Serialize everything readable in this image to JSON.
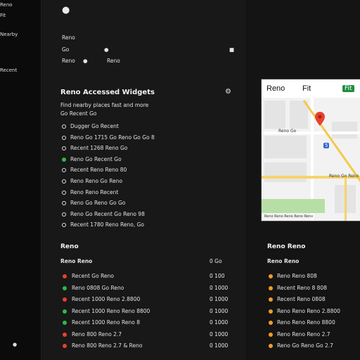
{
  "sidebar": {
    "items": [
      "Reno",
      "Fit",
      "Nearby",
      "Recent"
    ]
  },
  "header": {
    "line1": "●",
    "line2": "Reno",
    "line3_left": "Go",
    "line3_mid": "●",
    "line3_right": "■",
    "line4_left": "Reno",
    "line4_mid": "●",
    "line4_right": "Reno"
  },
  "search_section": {
    "title": "Reno Accessed Widgets",
    "subtitle_1": "Find nearby places fast and more",
    "subtitle_2": "Go Recent Go",
    "options": [
      {
        "label": "Dugger Go Recent",
        "style": "ring"
      },
      {
        "label": "Reno Go 1715 Go Reno Go Go 8",
        "style": "ring"
      },
      {
        "label": "Recent 1268 Reno Go",
        "style": "ring"
      },
      {
        "label": "Reno Go Recent Go",
        "style": "green"
      },
      {
        "label": "Recent Reno Reno 80",
        "style": "ring"
      },
      {
        "label": "Reno Reno Go Reno",
        "style": "ring"
      },
      {
        "label": "Reno Reno Recent",
        "style": "ring"
      },
      {
        "label": "Reno Go Reno Go Go",
        "style": "ring"
      },
      {
        "label": "Reno Go Recent Go Reno 98",
        "style": "ring"
      },
      {
        "label": "Recent 1780 Reno Reno, Go",
        "style": "ring"
      }
    ]
  },
  "map_card": {
    "top_left": "Reno",
    "top_mid": "Fit",
    "top_right_badge": "Fit",
    "label_1": "Reno Go",
    "label_2": "Reno Go Reno",
    "shield": "5",
    "footer": "Reno Reno Reno Reno Reno"
  },
  "list_left": {
    "title": "Reno",
    "column_header": "Reno Reno",
    "column_header_value": "0 Go",
    "rows": [
      {
        "label": "Recent Go Reno",
        "color": "#e8412c",
        "value": "0 100"
      },
      {
        "label": "Reno 0808 Go Reno",
        "color": "#2eb84a",
        "value": "0 1000"
      },
      {
        "label": "Recent 1000 Reno 2.8800",
        "color": "#e8412c",
        "value": "0 1000"
      },
      {
        "label": "Recent 1000 Reno Reno 8800",
        "color": "#2eb84a",
        "value": "0 1000"
      },
      {
        "label": "Recent 1000 Reno Reno 8",
        "color": "#2eb84a",
        "value": "0 1000"
      },
      {
        "label": "Reno 800 Reno 2.7",
        "color": "#e8412c",
        "value": "0 1000"
      },
      {
        "label": "Reno 800 Reno 2.7 & Reno",
        "color": "#e8412c",
        "value": "0 1000"
      }
    ]
  },
  "list_right": {
    "title": "Reno Reno",
    "column_header": "Reno Reno",
    "rows": [
      {
        "label": "Reno Reno 808",
        "color": "#f29b2c"
      },
      {
        "label": "Recent Reno 8 808",
        "color": "#f29b2c"
      },
      {
        "label": "Recent Reno 0808",
        "color": "#f29b2c"
      },
      {
        "label": "Reno Reno Reno 2.8800",
        "color": "#f29b2c"
      },
      {
        "label": "Reno Reno Reno 8800",
        "color": "#f29b2c"
      },
      {
        "label": "Reno Reno Reno 2.7",
        "color": "#f29b2c"
      },
      {
        "label": "Reno Go Reno Go 2.7",
        "color": "#f29b2c"
      }
    ]
  },
  "side_footer": "●",
  "gear": "⚙",
  "colors": {
    "accent_orange": "#f29b2c",
    "red": "#e8412c",
    "green": "#2eb84a"
  }
}
